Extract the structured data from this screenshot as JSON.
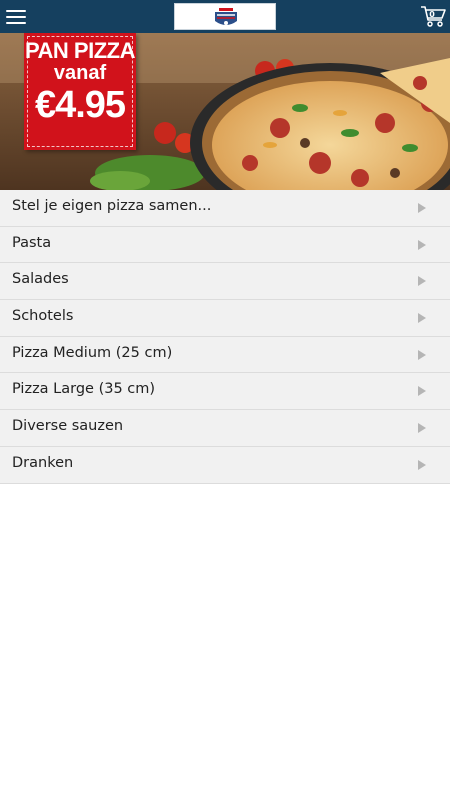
{
  "header": {
    "menu_icon": "hamburger-menu-icon",
    "logo_icon": "restaurant-logo-icon",
    "cart_icon": "shopping-cart-icon",
    "cart_count": "0",
    "bar_color": "#15405f"
  },
  "banner": {
    "promo_line1": "PAN PIZZA",
    "promo_line2": "vanaf",
    "promo_price": "€4.95",
    "promo_color": "#d1121b"
  },
  "menu": {
    "items": [
      {
        "label": "Stel je eigen pizza samen..."
      },
      {
        "label": "Pasta"
      },
      {
        "label": "Salades"
      },
      {
        "label": "Schotels"
      },
      {
        "label": "Pizza Medium (25 cm)"
      },
      {
        "label": "Pizza Large (35 cm)"
      },
      {
        "label": "Diverse sauzen"
      },
      {
        "label": "Dranken"
      }
    ],
    "chevron_icon": "chevron-right-icon"
  }
}
